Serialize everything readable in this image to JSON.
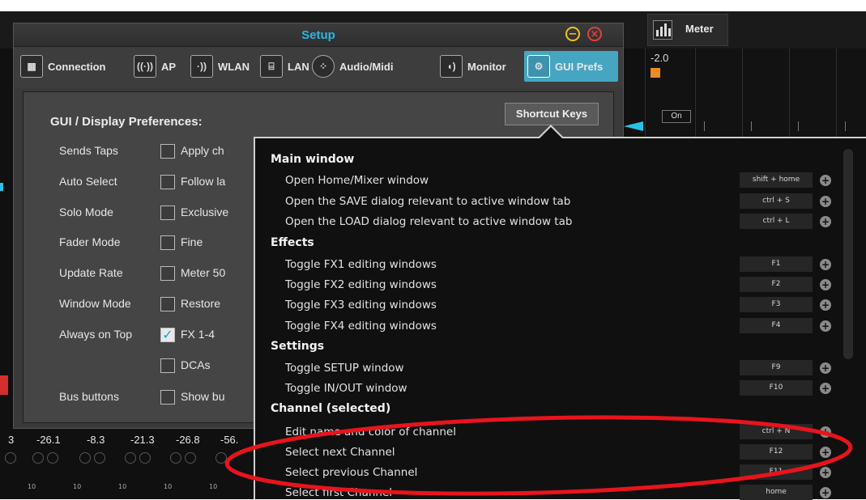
{
  "meter": {
    "label": "Meter"
  },
  "mixer": {
    "top_value": "-2.0",
    "on_label": "On",
    "bottom_values": [
      "3",
      "-26.1",
      "-8.3",
      "-21.3",
      "-26.8",
      "-56."
    ],
    "scale_label": "10",
    "colors": {
      "accent_orange": "#f08a24",
      "accent_cyan": "#27c3e6",
      "alert_red": "#d32f2f"
    }
  },
  "setup": {
    "title": "Setup",
    "tabs": [
      {
        "label": "Connection",
        "icon": "connection-icon"
      },
      {
        "label": "AP",
        "icon": "antenna-icon"
      },
      {
        "label": "WLAN",
        "icon": "wifi-icon"
      },
      {
        "label": "LAN",
        "icon": "ethernet-icon"
      },
      {
        "label": "Audio/Midi",
        "icon": "midi-connector-icon"
      },
      {
        "label": "Monitor",
        "icon": "speaker-icon"
      },
      {
        "label": "GUI Prefs",
        "icon": "gears-icon"
      }
    ],
    "heading": "GUI / Display Preferences:",
    "shortcut_button": "Shortcut Keys",
    "prefs": [
      {
        "label": "Sends Taps",
        "option": "Apply ch",
        "checked": false
      },
      {
        "label": "Auto Select",
        "option": "Follow la",
        "checked": false
      },
      {
        "label": "Solo Mode",
        "option": "Exclusive",
        "checked": false
      },
      {
        "label": "Fader Mode",
        "option": "Fine",
        "checked": false
      },
      {
        "label": "Update Rate",
        "option": "Meter 50",
        "checked": false
      },
      {
        "label": "Window Mode",
        "option": "Restore",
        "checked": false
      },
      {
        "label": "Always on Top",
        "option": "FX 1-4",
        "checked": true
      },
      {
        "label": "",
        "option": "DCAs",
        "checked": false
      },
      {
        "label": "Bus buttons",
        "option": "Show bu",
        "checked": false
      }
    ]
  },
  "shortcuts": {
    "sections": [
      {
        "title": "Main window",
        "rows": [
          {
            "label": "Open Home/Mixer window",
            "key": "shift + home"
          },
          {
            "label": "Open the SAVE dialog relevant to active window tab",
            "key": "ctrl + S"
          },
          {
            "label": "Open the LOAD dialog relevant to active window tab",
            "key": "ctrl + L"
          }
        ]
      },
      {
        "title": "Effects",
        "rows": [
          {
            "label": "Toggle FX1 editing windows",
            "key": "F1"
          },
          {
            "label": "Toggle FX2 editing windows",
            "key": "F2"
          },
          {
            "label": "Toggle FX3 editing windows",
            "key": "F3"
          },
          {
            "label": "Toggle FX4 editing windows",
            "key": "F4"
          }
        ]
      },
      {
        "title": "Settings",
        "rows": [
          {
            "label": "Toggle SETUP window",
            "key": "F9"
          },
          {
            "label": "Toggle IN/OUT window",
            "key": "F10"
          }
        ]
      },
      {
        "title": "Channel (selected)",
        "rows": [
          {
            "label": "Edit name and color of channel",
            "key": "ctrl + N"
          },
          {
            "label": "Select next Channel",
            "key": "F12"
          },
          {
            "label": "Select previous Channel",
            "key": "F11"
          },
          {
            "label": "Select first Channel",
            "key": "home"
          }
        ]
      }
    ]
  },
  "annotation": {
    "ellipse_color": "#e8141c"
  }
}
